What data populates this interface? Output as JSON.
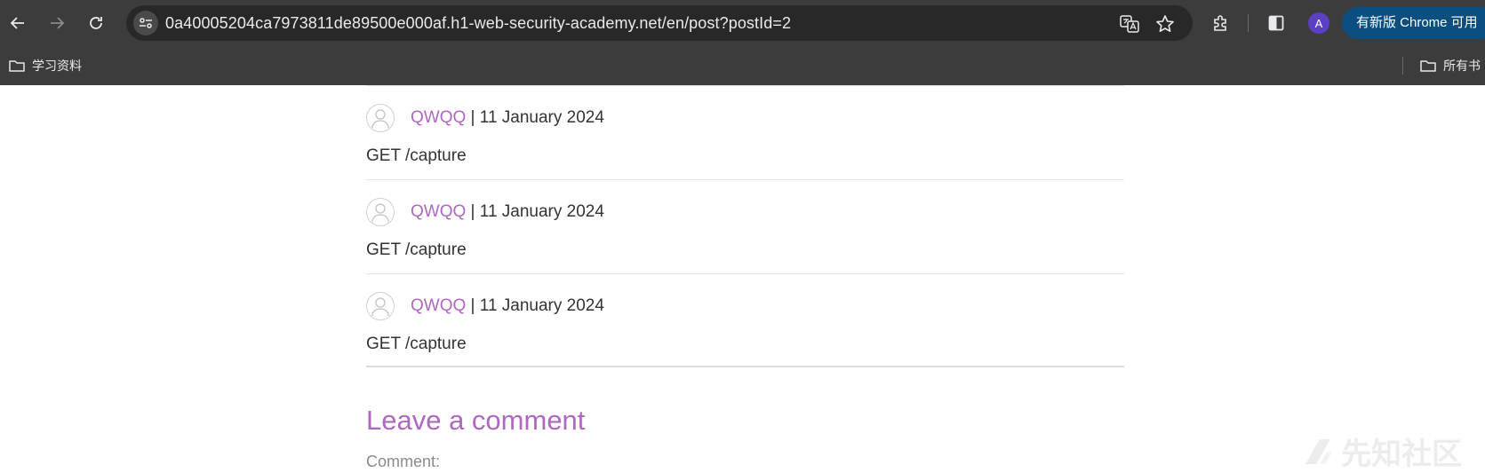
{
  "browser": {
    "url": "0a40005204ca7973811de89500e000af.h1-web-security-academy.net/en/post?postId=2",
    "profile_initial": "A",
    "update_label": "有新版 Chrome 可用",
    "bookmarks": [
      {
        "label": "学习资料"
      }
    ],
    "all_bookmarks_label": "所有书"
  },
  "comments": [
    {
      "author": "QWQQ",
      "separator": " | ",
      "date": "11 January 2024",
      "body": "GET /capture"
    },
    {
      "author": "QWQQ",
      "separator": " | ",
      "date": "11 January 2024",
      "body": "GET /capture"
    },
    {
      "author": "QWQQ",
      "separator": " | ",
      "date": "11 January 2024",
      "body": "GET /capture"
    }
  ],
  "leave_comment": {
    "title": "Leave a comment",
    "comment_label": "Comment:"
  },
  "watermark": {
    "text": "先知社区"
  },
  "colors": {
    "chrome_bg": "#3c3c3c",
    "omnibox_bg": "#282828",
    "accent_purple": "#ae68c0",
    "update_pill": "#0b4f82",
    "profile": "#5b3fc4"
  }
}
